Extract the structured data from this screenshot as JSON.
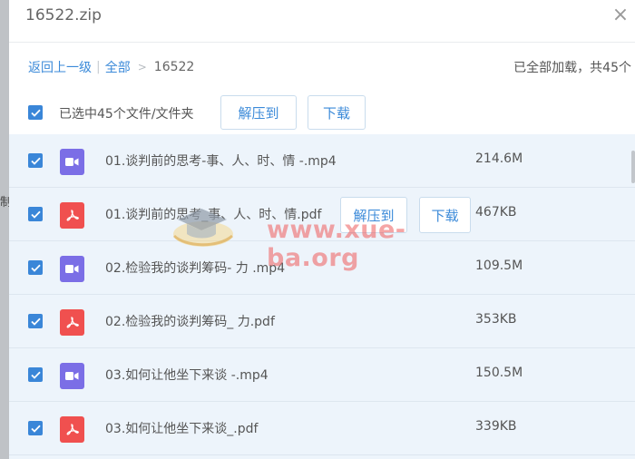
{
  "dialog": {
    "title": "16522.zip",
    "close_icon": "close-icon"
  },
  "breadcrumb": {
    "back_label": "返回上一级",
    "separator": "|",
    "all_label": "全部",
    "arrow": ">",
    "current": "16522"
  },
  "status": {
    "loaded_text": "已全部加载，共45个"
  },
  "selection": {
    "checked": true,
    "text": "已选中45个文件/文件夹",
    "extract_label": "解压到",
    "download_label": "下载"
  },
  "files": [
    {
      "name": "01.谈判前的思考-事、人、时、情 -.mp4",
      "size": "214.6M",
      "type": "video",
      "icon": "video-file-icon",
      "checked": true
    },
    {
      "name": "01.谈判前的思考_事、人、时、情.pdf",
      "size": "467KB",
      "type": "pdf",
      "icon": "pdf-file-icon",
      "checked": true,
      "hover_extract": "解压到",
      "hover_download": "下载"
    },
    {
      "name": "02.检验我的谈判筹码- 力 .mp4",
      "size": "109.5M",
      "type": "video",
      "icon": "video-file-icon",
      "checked": true
    },
    {
      "name": "02.检验我的谈判筹码_ 力.pdf",
      "size": "353KB",
      "type": "pdf",
      "icon": "pdf-file-icon",
      "checked": true
    },
    {
      "name": "03.如何让他坐下来谈 -.mp4",
      "size": "150.5M",
      "type": "video",
      "icon": "video-file-icon",
      "checked": true
    },
    {
      "name": "03.如何让他坐下来谈_.pdf",
      "size": "339KB",
      "type": "pdf",
      "icon": "pdf-file-icon",
      "checked": true
    }
  ],
  "background": {
    "cut_text": "制"
  },
  "watermark": {
    "text": "www.xue-ba.org",
    "logo": "graduation-cap-logo"
  },
  "colors": {
    "accent": "#3b8ad9",
    "checkbox": "#3a86d8",
    "video_icon": "#7b6ee6",
    "pdf_icon": "#f0504f",
    "list_bg": "#edf4fb"
  }
}
